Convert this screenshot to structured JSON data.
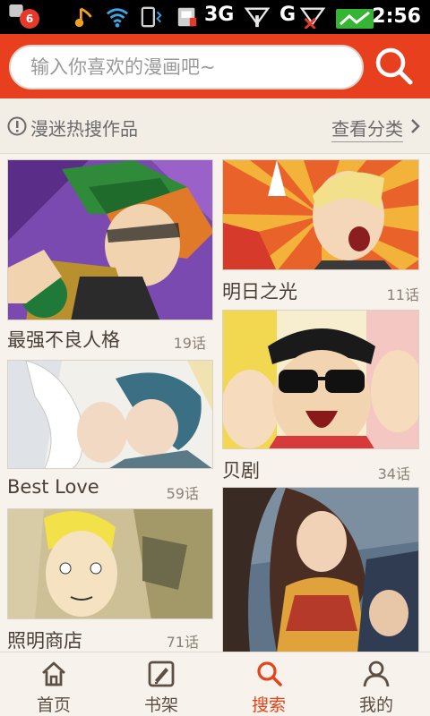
{
  "status_bar": {
    "notification_count": "6",
    "network_1": "3G",
    "network_2": "G",
    "time": "2:56"
  },
  "search": {
    "placeholder": "输入你喜欢的漫画吧~"
  },
  "section": {
    "title": "漫迷热搜作品",
    "category_link": "查看分类"
  },
  "comics": [
    {
      "title": "最强不良人格",
      "count": "19话"
    },
    {
      "title": "明日之光",
      "count": "11话"
    },
    {
      "title": "Best Love",
      "count": "59话"
    },
    {
      "title": "贝剧",
      "count": "34话"
    },
    {
      "title": "照明商店",
      "count": "71话"
    }
  ],
  "bottom_nav": [
    {
      "label": "首页",
      "icon": "home-icon"
    },
    {
      "label": "书架",
      "icon": "bookshelf-icon"
    },
    {
      "label": "搜索",
      "icon": "search-icon"
    },
    {
      "label": "我的",
      "icon": "user-icon"
    }
  ],
  "colors": {
    "brand_red": "#e8401f",
    "active_nav": "#e84219",
    "background": "#f7f3ec"
  }
}
